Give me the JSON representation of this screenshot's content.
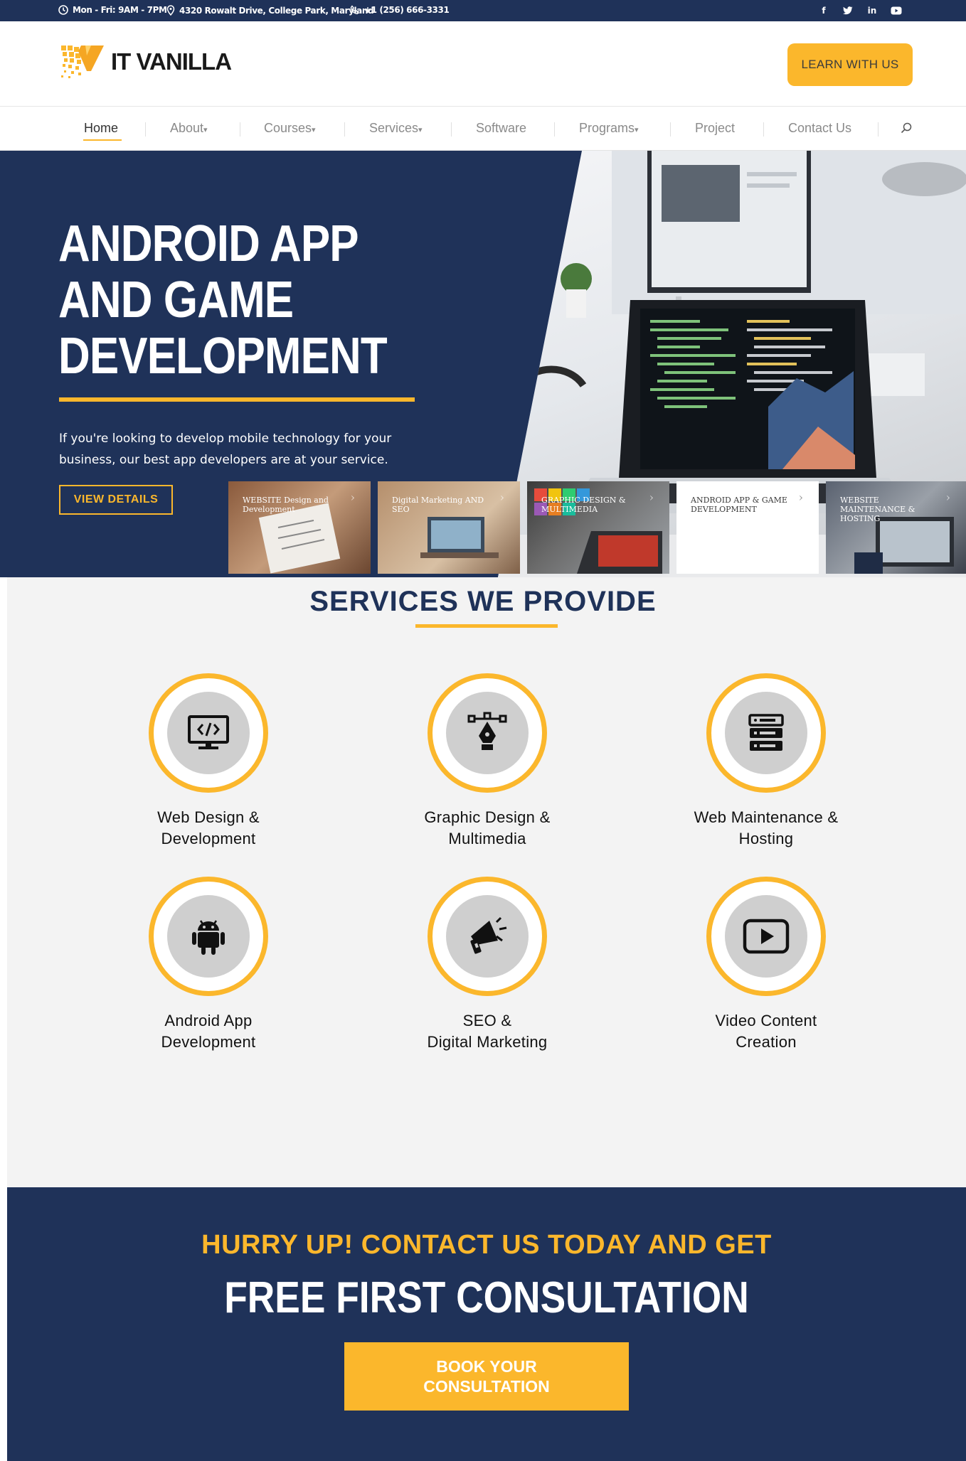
{
  "topbar": {
    "hours": "Mon - Fri: 9AM - 7PM",
    "address": "4320 Rowalt Drive, College Park, Maryland",
    "phone": "+1 (256) 666-3331",
    "social": [
      "facebook-icon",
      "twitter-icon",
      "linkedin-icon",
      "youtube-icon"
    ]
  },
  "header": {
    "logo_text": "IT VANILLA",
    "cta_label": "LEARN WITH US"
  },
  "nav": {
    "items": [
      {
        "label": "Home",
        "active": true
      },
      {
        "label": "About",
        "dropdown": true
      },
      {
        "label": "Courses",
        "dropdown": true
      },
      {
        "label": "Services",
        "dropdown": true
      },
      {
        "label": "Software"
      },
      {
        "label": "Programs",
        "dropdown": true
      },
      {
        "label": "Project"
      },
      {
        "label": "Contact Us"
      }
    ],
    "search_icon": "search-icon"
  },
  "hero": {
    "title": "ANDROID APP AND GAME DEVELOPMENT",
    "description": "If you're looking to develop mobile technology for your business, our best app developers are at your service.",
    "button_label": "VIEW DETAILS",
    "slides": [
      {
        "label": "WEBSITE Design and Development"
      },
      {
        "label": "Digital Marketing AND SEO"
      },
      {
        "label": "GRAPHIC DESIGN & MULTIMEDIA"
      },
      {
        "label": "ANDROID APP & GAME DEVELOPMENT",
        "active": true
      },
      {
        "label": "WEBSITE MAINTENANCE & HOSTING"
      }
    ]
  },
  "services": {
    "title": "SERVICES WE PROVIDE",
    "items": [
      {
        "line1": "Web Design &",
        "line2": "Development",
        "icon": "code-monitor-icon"
      },
      {
        "line1": "Graphic Design &",
        "line2": "Multimedia",
        "icon": "pen-tool-icon"
      },
      {
        "line1": "Web Maintenance &",
        "line2": "Hosting",
        "icon": "server-icon"
      },
      {
        "line1": "Android App",
        "line2": "Development",
        "icon": "android-icon"
      },
      {
        "line1": "SEO &",
        "line2": "Digital Marketing",
        "icon": "megaphone-icon"
      },
      {
        "line1": "Video Content",
        "line2": "Creation",
        "icon": "play-icon"
      }
    ]
  },
  "cta": {
    "line1": "HURRY UP! CONTACT US TODAY AND GET",
    "line2": "FREE FIRST CONSULTATION",
    "button_line1": "BOOK YOUR",
    "button_line2": "CONSULTATION"
  },
  "colors": {
    "navy": "#1f3259",
    "accent": "#fbb72c",
    "background": "#f3f3f3"
  }
}
